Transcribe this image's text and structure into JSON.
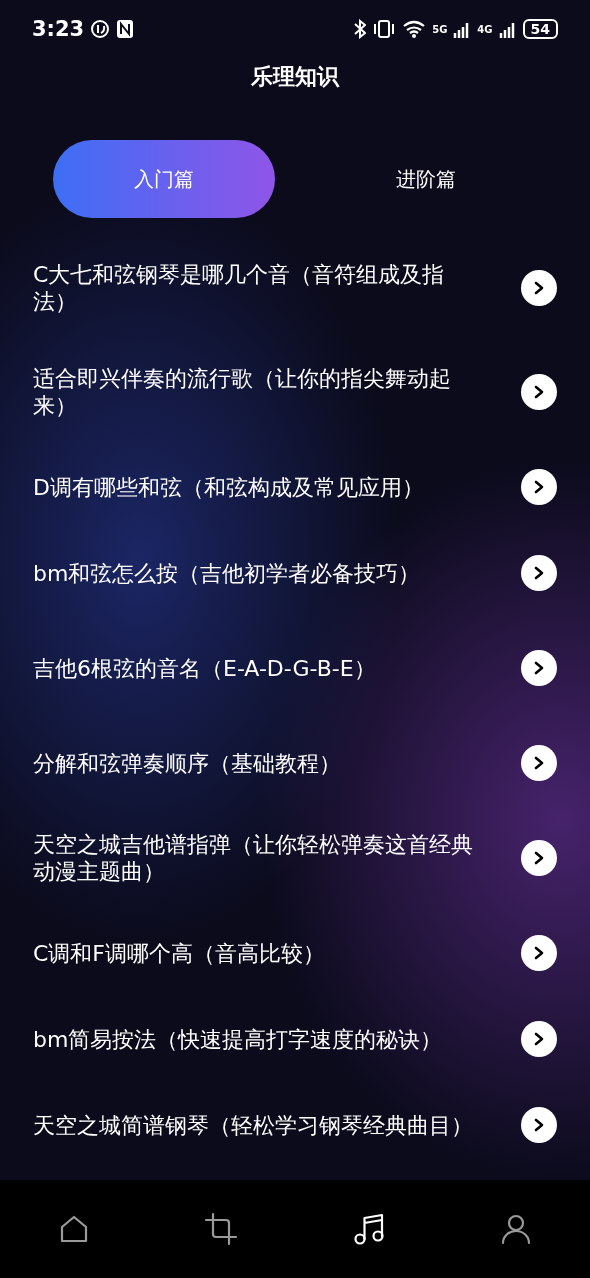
{
  "status_bar": {
    "time": "3:23",
    "net_5g": "5G",
    "net_4g": "4G",
    "battery": "54"
  },
  "title": "乐理知识",
  "tabs": [
    {
      "label": "入门篇",
      "selected": true
    },
    {
      "label": "进阶篇",
      "selected": false
    }
  ],
  "articles": [
    "C大七和弦钢琴是哪几个音（音符组成及指法）",
    "适合即兴伴奏的流行歌（让你的指尖舞动起来）",
    "D调有哪些和弦（和弦构成及常见应用）",
    "bm和弦怎么按（吉他初学者必备技巧）",
    "吉他6根弦的音名（E-A-D-G-B-E）",
    "分解和弦弹奏顺序（基础教程）",
    "天空之城吉他谱指弹（让你轻松弹奏这首经典动漫主题曲）",
    "C调和F调哪个高（音高比较）",
    "bm简易按法（快速提高打字速度的秘诀）",
    "天空之城简谱钢琴（轻松学习钢琴经典曲目）"
  ],
  "nav": [
    {
      "kind": "home",
      "selected": false
    },
    {
      "kind": "crop",
      "selected": false
    },
    {
      "kind": "music",
      "selected": true
    },
    {
      "kind": "profile",
      "selected": false
    }
  ]
}
